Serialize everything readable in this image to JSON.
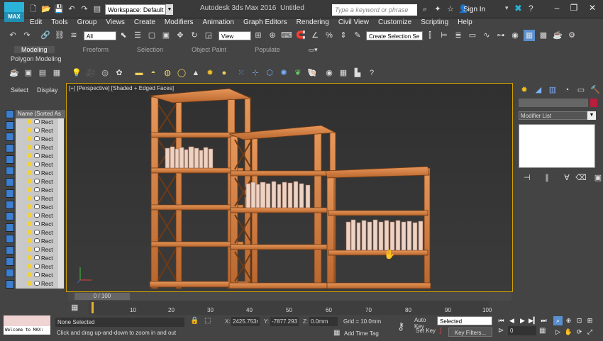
{
  "app": {
    "logo_text": "MAX",
    "workspace": "Workspace: Default",
    "title": "Autodesk 3ds Max 2016",
    "document": "Untitled",
    "search_placeholder": "Type a keyword or phrase",
    "signin": "Sign In"
  },
  "menus": [
    "Edit",
    "Tools",
    "Group",
    "Views",
    "Create",
    "Modifiers",
    "Animation",
    "Graph Editors",
    "Rendering",
    "Civil View",
    "Customize",
    "Scripting",
    "Help"
  ],
  "toolbar": {
    "selection_filter": "All",
    "reference_coord": "View",
    "named_selection": "Create Selection Se"
  },
  "ribbon": {
    "tabs": [
      "Modeling",
      "Freeform",
      "Selection",
      "Object Paint",
      "Populate"
    ],
    "active": "Modeling",
    "panel_label": "Polygon Modeling"
  },
  "scene_explorer": {
    "tabs": [
      "Select",
      "Display"
    ],
    "column": "Name (Sorted As",
    "item_label": "Rect",
    "item_count": 20
  },
  "viewport": {
    "label": "[+] [Perspective] [Shaded + Edged Faces]"
  },
  "command_panel": {
    "modifier_list": "Modifier List",
    "color_swatch": "#b81e3d"
  },
  "timeline": {
    "slider": "0 / 100",
    "ticks": [
      "10",
      "20",
      "30",
      "40",
      "50",
      "60",
      "70",
      "80",
      "90",
      "100"
    ]
  },
  "status": {
    "maxscript": "Welcome to MAX:",
    "selection": "None Selected",
    "hint": "Click and drag up-and-down to zoom in and out",
    "x_label": "X:",
    "x_value": "2425.753r",
    "y_label": "Y:",
    "y_value": "-7877.293",
    "z_label": "Z:",
    "z_value": "0.0mm",
    "grid": "Grid = 10.0mm",
    "add_time_tag": "Add Time Tag",
    "auto_key": "Auto Key",
    "set_key": "Set Key",
    "key_mode": "Selected",
    "key_filters": "Key Filters...",
    "frame": "0"
  },
  "colors": {
    "viewport_border": "#d0a000",
    "shelf_wood": "#d7834a"
  }
}
